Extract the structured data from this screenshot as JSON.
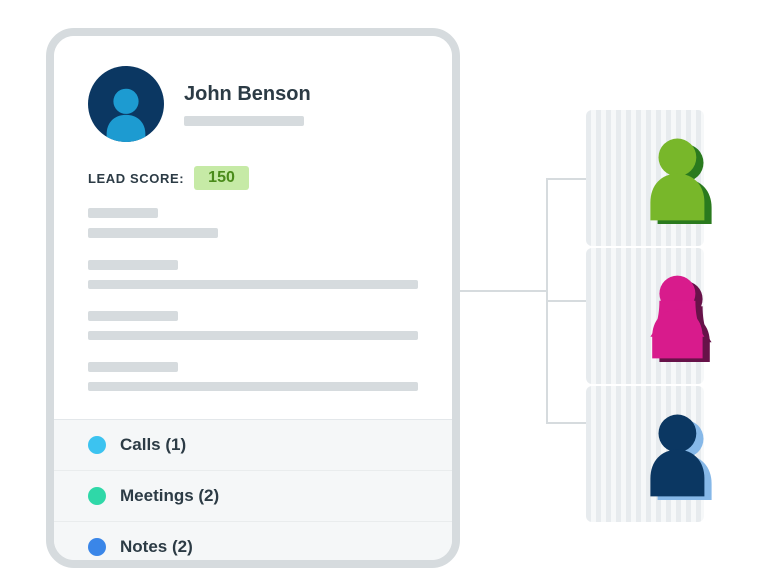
{
  "profile": {
    "name": "John Benson",
    "lead_score_label": "LEAD SCORE:",
    "lead_score_value": "150"
  },
  "activities": [
    {
      "label": "Calls (1)",
      "color": "#3cc3f0"
    },
    {
      "label": "Meetings (2)",
      "color": "#2fd8a8"
    },
    {
      "label": "Notes (2)",
      "color": "#3a86e8"
    }
  ],
  "contacts": [
    {
      "fill": "#78b72a",
      "shadow": "#2a7a1e"
    },
    {
      "fill": "#d81b8c",
      "shadow": "#671249"
    },
    {
      "fill": "#0b3762",
      "shadow": "#86b8e8"
    }
  ]
}
